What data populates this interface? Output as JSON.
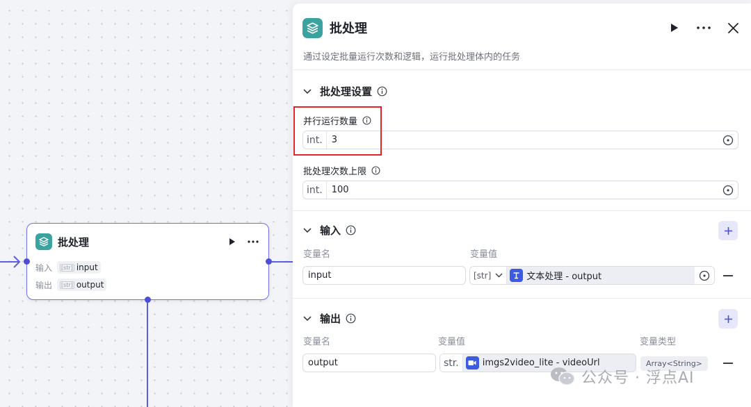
{
  "node": {
    "title": "批处理",
    "input_label": "输入",
    "input_type": "[str]",
    "input_value": "input",
    "output_label": "输出",
    "output_type": "[str]",
    "output_value": "output"
  },
  "panel": {
    "title": "批处理",
    "description": "通过设定批量运行次数和逻辑，运行批处理体内的任务",
    "settings": {
      "section_title": "批处理设置",
      "parallel_label": "并行运行数量",
      "parallel_prefix": "int.",
      "parallel_value": "3",
      "max_label": "批处理次数上限",
      "max_prefix": "int.",
      "max_value": "100"
    },
    "inputs": {
      "section_title": "输入",
      "col_name": "变量名",
      "col_value": "变量值",
      "row_name": "input",
      "row_type": "[str]",
      "row_ref": "文本处理 - output"
    },
    "outputs": {
      "section_title": "输出",
      "col_name": "变量名",
      "col_value": "变量值",
      "col_type": "变量类型",
      "row_name": "output",
      "row_prefix": "str.",
      "row_ref": "imgs2video_lite - videoUrl",
      "row_type": "Array<String>"
    }
  },
  "watermark": "公众号 · 浮点AI",
  "colors": {
    "accent": "#5b5ee0",
    "app_icon": "#3aa3a0",
    "highlight": "#e3222a"
  }
}
